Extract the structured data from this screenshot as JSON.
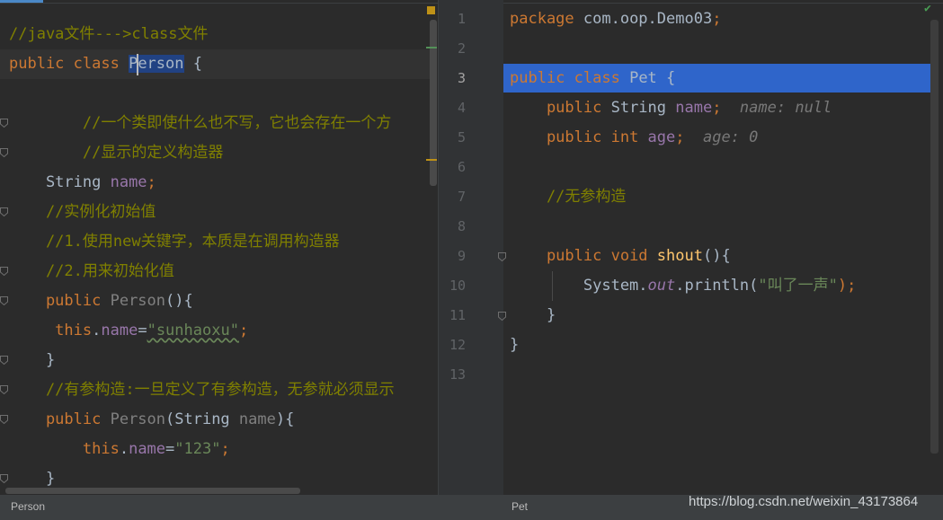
{
  "left_editor": {
    "tab_label": "Person",
    "lines": [
      {
        "tokens": [
          {
            "t": "//java文件--->class文件",
            "c": "cm"
          }
        ]
      },
      {
        "tokens": [
          {
            "t": "public ",
            "c": "kw"
          },
          {
            "t": "class ",
            "c": "kw"
          },
          {
            "t": "Person",
            "c": "cls-hl"
          },
          {
            "t": " {",
            "c": "id"
          }
        ]
      },
      {
        "tokens": []
      },
      {
        "tokens": [
          {
            "t": "        //一个类即使什么也不写，它也会存在一个方",
            "c": "cm"
          }
        ]
      },
      {
        "tokens": [
          {
            "t": "        //显示的定义构造器",
            "c": "cm"
          }
        ]
      },
      {
        "tokens": [
          {
            "t": "    String ",
            "c": "id"
          },
          {
            "t": "name",
            "c": "field"
          },
          {
            "t": ";",
            "c": "kw"
          }
        ]
      },
      {
        "tokens": [
          {
            "t": "    //实例化初始值",
            "c": "cm"
          }
        ]
      },
      {
        "tokens": [
          {
            "t": "    //1.使用new关键字，本质是在调用构造器",
            "c": "cm"
          }
        ]
      },
      {
        "tokens": [
          {
            "t": "    //2.用来初始化值",
            "c": "cm"
          }
        ]
      },
      {
        "tokens": [
          {
            "t": "    public ",
            "c": "kw"
          },
          {
            "t": "Person",
            "c": "gray"
          },
          {
            "t": "(){",
            "c": "id"
          }
        ]
      },
      {
        "tokens": [
          {
            "t": "     this",
            "c": "kw"
          },
          {
            "t": ".",
            "c": "id"
          },
          {
            "t": "name",
            "c": "field"
          },
          {
            "t": "=",
            "c": "id"
          },
          {
            "t": "\"sunhaoxu\"",
            "c": "str wavy"
          },
          {
            "t": ";",
            "c": "kw"
          }
        ]
      },
      {
        "tokens": [
          {
            "t": "    }",
            "c": "id"
          }
        ]
      },
      {
        "tokens": [
          {
            "t": "    //有参构造:一旦定义了有参构造，无参就必须显示",
            "c": "cm"
          }
        ]
      },
      {
        "tokens": [
          {
            "t": "    public ",
            "c": "kw"
          },
          {
            "t": "Person",
            "c": "gray"
          },
          {
            "t": "(String ",
            "c": "id"
          },
          {
            "t": "name",
            "c": "gray"
          },
          {
            "t": "){",
            "c": "id"
          }
        ]
      },
      {
        "tokens": [
          {
            "t": "        this",
            "c": "kw"
          },
          {
            "t": ".",
            "c": "id"
          },
          {
            "t": "name",
            "c": "field"
          },
          {
            "t": "=",
            "c": "id"
          },
          {
            "t": "\"123\"",
            "c": "str"
          },
          {
            "t": ";",
            "c": "kw"
          }
        ]
      },
      {
        "tokens": [
          {
            "t": "    }",
            "c": "id"
          }
        ]
      }
    ]
  },
  "right_editor": {
    "tab_label": "Pet",
    "line_numbers": [
      "1",
      "2",
      "3",
      "4",
      "5",
      "6",
      "7",
      "8",
      "9",
      "10",
      "11",
      "12",
      "13"
    ],
    "lines": [
      {
        "tokens": [
          {
            "t": "package ",
            "c": "kw"
          },
          {
            "t": "com.oop.Demo03",
            "c": "id"
          },
          {
            "t": ";",
            "c": "kw"
          }
        ]
      },
      {
        "tokens": []
      },
      {
        "tokens": [
          {
            "t": "public ",
            "c": "kw"
          },
          {
            "t": "class ",
            "c": "kw"
          },
          {
            "t": "Pet ",
            "c": "id"
          },
          {
            "t": "{",
            "c": "id"
          }
        ]
      },
      {
        "tokens": [
          {
            "t": "    public ",
            "c": "kw"
          },
          {
            "t": "String ",
            "c": "id"
          },
          {
            "t": "name",
            "c": "field"
          },
          {
            "t": ";  ",
            "c": "kw"
          },
          {
            "t": "name: null",
            "c": "hint"
          }
        ]
      },
      {
        "tokens": [
          {
            "t": "    public ",
            "c": "kw"
          },
          {
            "t": "int ",
            "c": "kw"
          },
          {
            "t": "age",
            "c": "field"
          },
          {
            "t": ";  ",
            "c": "kw"
          },
          {
            "t": "age: 0",
            "c": "hint"
          }
        ]
      },
      {
        "tokens": []
      },
      {
        "tokens": [
          {
            "t": "    //无参构造",
            "c": "cm"
          }
        ]
      },
      {
        "tokens": []
      },
      {
        "tokens": [
          {
            "t": "    public ",
            "c": "kw"
          },
          {
            "t": "void ",
            "c": "kw"
          },
          {
            "t": "shout",
            "c": "fn"
          },
          {
            "t": "(){",
            "c": "id"
          }
        ]
      },
      {
        "tokens": [
          {
            "t": "        System.",
            "c": "id"
          },
          {
            "t": "out",
            "c": "stat"
          },
          {
            "t": ".println(",
            "c": "id"
          },
          {
            "t": "\"叫了一声\"",
            "c": "str"
          },
          {
            "t": ");",
            "c": "kw"
          }
        ]
      },
      {
        "tokens": [
          {
            "t": "    }",
            "c": "id"
          }
        ]
      },
      {
        "tokens": [
          {
            "t": "}",
            "c": "id"
          }
        ]
      },
      {
        "tokens": []
      }
    ]
  },
  "watermark": "https://blog.csdn.net/weixin_43173864",
  "colors": {
    "keyword": "#cc7832",
    "comment": "#808000",
    "field": "#9876aa",
    "string": "#6a8759",
    "method": "#ffc66d",
    "selection": "#2f65ca"
  }
}
